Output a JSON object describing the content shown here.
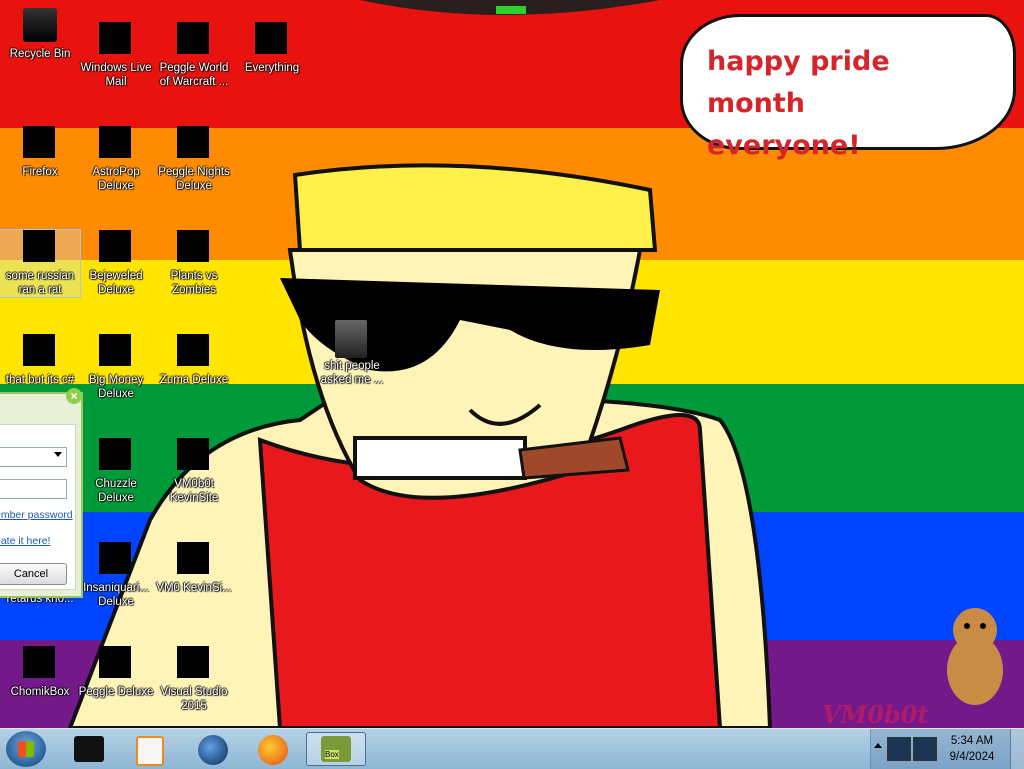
{
  "desktop": {
    "colors": [
      "#e8130f",
      "#ff8c00",
      "#ffe500",
      "#009a3a",
      "#0044ff",
      "#73198a"
    ],
    "wallpaper_text": "VM0b0t",
    "bubble": {
      "line1": "happy pride month",
      "line2": "everyone!"
    },
    "icons": [
      {
        "label": "Recycle Bin"
      },
      {
        "label": "Windows Live Mail"
      },
      {
        "label": "Peggle World of Warcraft ..."
      },
      {
        "label": "Everything"
      },
      {
        "label": "Firefox"
      },
      {
        "label": "AstroPop Deluxe"
      },
      {
        "label": "Peggle Nights Deluxe"
      },
      {
        "label": "some russian ran a rat"
      },
      {
        "label": "Bejeweled Deluxe"
      },
      {
        "label": "Plants vs Zombies"
      },
      {
        "label": "that but its c#"
      },
      {
        "label": "Big Money Deluxe"
      },
      {
        "label": "Zuma Deluxe"
      },
      {
        "label": "Chuzzle Deluxe"
      },
      {
        "label": "VM0b0t KevinSite"
      },
      {
        "label": "retards kno..."
      },
      {
        "label": "Insaniquari... Deluxe"
      },
      {
        "label": "VM0 KevinSi..."
      },
      {
        "label": "ChomikBox"
      },
      {
        "label": "Peggle Deluxe"
      },
      {
        "label": "Visual Studio 2015"
      },
      {
        "label": "shit people asked me ..."
      }
    ]
  },
  "dialog": {
    "remember_password": "ember password",
    "create_link": "eate it here!",
    "cancel": "Cancel"
  },
  "taskbar": {
    "active_app": "Box",
    "time": "5:34 AM",
    "date": "9/4/2024"
  }
}
